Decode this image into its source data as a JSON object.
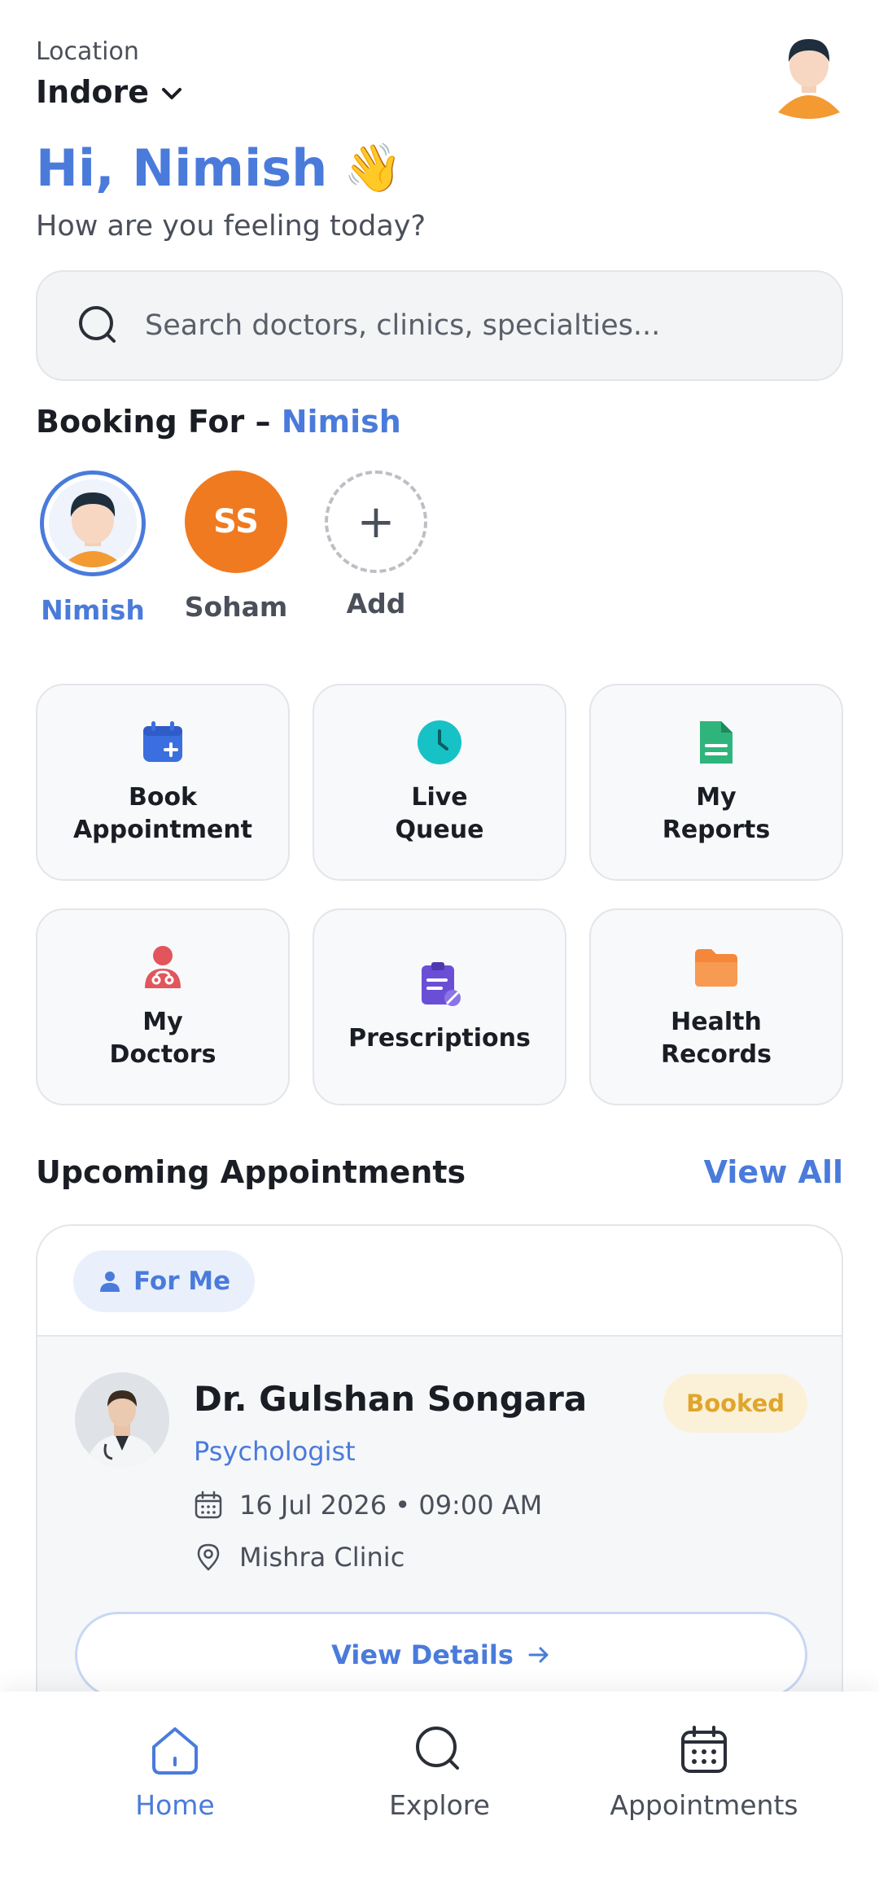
{
  "header": {
    "location_label": "Location",
    "city": "Indore"
  },
  "greeting": {
    "title": "Hi, Nimish",
    "emoji": "👋",
    "subtitle": "How are you feeling today?"
  },
  "search": {
    "placeholder": "Search doctors, clinics, specialties..."
  },
  "booking": {
    "title": "Booking For –",
    "selected": "Nimish",
    "members": [
      {
        "label": "Nimish",
        "selected": true
      },
      {
        "label": "Soham",
        "initials": "SS"
      },
      {
        "label": "Add",
        "icon": "+"
      }
    ]
  },
  "tiles": [
    {
      "label": "Book\nAppointment",
      "icon": "calendar-plus-icon",
      "color": "#3b6fe0"
    },
    {
      "label": "Live\nQueue",
      "icon": "clock-icon",
      "color": "#16c2c6"
    },
    {
      "label": "My\nReports",
      "icon": "document-icon",
      "color": "#2fb57c"
    },
    {
      "label": "My\nDoctors",
      "icon": "doctor-icon",
      "color": "#e2555c"
    },
    {
      "label": "Prescriptions",
      "icon": "prescription-clipboard-icon",
      "color": "#6a4fd6"
    },
    {
      "label": "Health\nRecords",
      "icon": "folder-icon",
      "color": "#f5873a"
    }
  ],
  "upcoming": {
    "title": "Upcoming Appointments",
    "view_all": "View All",
    "filter_chip": "For Me",
    "appointment": {
      "doctor": "Dr. Gulshan Songara",
      "specialty": "Psychologist",
      "status": "Booked",
      "datetime": "16 Jul 2026 • 09:00 AM",
      "clinic": "Mishra Clinic",
      "details_button": "View Details"
    }
  },
  "nav": {
    "items": [
      {
        "label": "Home",
        "active": true
      },
      {
        "label": "Explore"
      },
      {
        "label": "Appointments"
      }
    ]
  },
  "colors": {
    "accent": "#4a7bdb",
    "badge_text": "#e0a52a",
    "soham_avatar": "#f07a20"
  }
}
